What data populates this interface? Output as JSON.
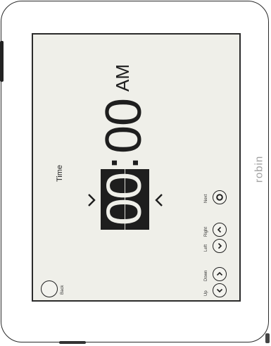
{
  "brand": "robin",
  "screen": {
    "title": "Time",
    "time": {
      "hour": "00",
      "separator": ":",
      "minutes": "00",
      "period": "AM"
    },
    "nav_buttons": [
      {
        "label": "Up",
        "icon": "chevron-left-icon"
      },
      {
        "label": "Down",
        "icon": "chevron-right-icon"
      },
      {
        "label": "Left",
        "icon": "chevron-down-icon"
      },
      {
        "label": "Right",
        "icon": "chevron-up-icon"
      },
      {
        "label": "Next",
        "icon": "ring-icon"
      }
    ],
    "back_label": "Back"
  }
}
